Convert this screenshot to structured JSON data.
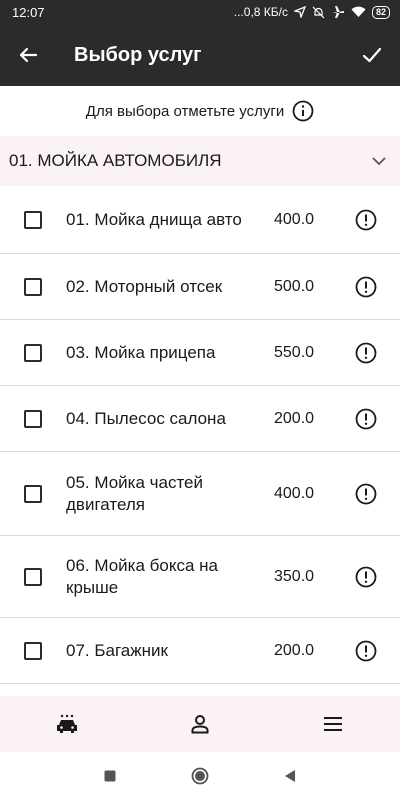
{
  "status_bar": {
    "time": "12:07",
    "network_speed": "...0,8 КБ/с",
    "battery": "82"
  },
  "app_bar": {
    "title": "Выбор услуг"
  },
  "hint": {
    "text": "Для выбора отметьте услуги"
  },
  "category": {
    "title": "01. МОЙКА АВТОМОБИЛЯ"
  },
  "services": [
    {
      "name": "01. Мойка днища авто",
      "price": "400.0"
    },
    {
      "name": "02. Моторный отсек",
      "price": "500.0"
    },
    {
      "name": "03. Мойка прицепа",
      "price": "550.0"
    },
    {
      "name": "04. Пылесос салона",
      "price": "200.0"
    },
    {
      "name": "05. Мойка частей двигателя",
      "price": "400.0"
    },
    {
      "name": "06. Мойка бокса на крыше",
      "price": "350.0"
    },
    {
      "name": "07. Багажник",
      "price": "200.0"
    }
  ],
  "colors": {
    "app_bar": "#2b2b2b",
    "category_bg": "#fbf3f3",
    "divider": "#dcdcdc"
  }
}
